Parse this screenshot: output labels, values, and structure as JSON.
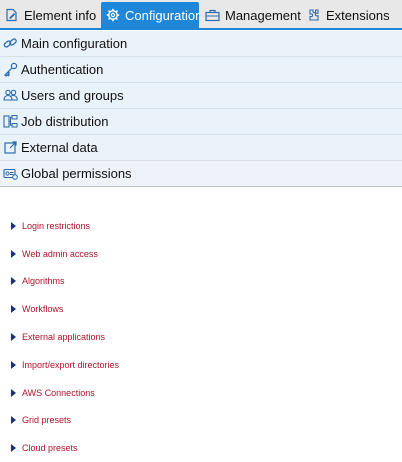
{
  "tabs": [
    {
      "label": "Element info",
      "icon": "edit-document-icon"
    },
    {
      "label": "Configuration",
      "icon": "gear-icon",
      "active": true
    },
    {
      "label": "Management",
      "icon": "toolbox-icon"
    },
    {
      "label": "Extensions",
      "icon": "puzzle-icon"
    }
  ],
  "sections": [
    {
      "label": "Main configuration",
      "icon": "link-chain-icon"
    },
    {
      "label": "Authentication",
      "icon": "key-icon"
    },
    {
      "label": "Users and groups",
      "icon": "users-icon"
    },
    {
      "label": "Job distribution",
      "icon": "network-distribution-icon"
    },
    {
      "label": "External data",
      "icon": "external-data-icon"
    },
    {
      "label": "Global permissions",
      "icon": "global-permissions-icon"
    }
  ],
  "permissions": [
    {
      "label": "Login restrictions"
    },
    {
      "label": "Web admin access"
    },
    {
      "label": "Algorithms"
    },
    {
      "label": "Workflows"
    },
    {
      "label": "External applications"
    },
    {
      "label": "Import/export directories"
    },
    {
      "label": "AWS Connections"
    },
    {
      "label": "Grid presets"
    },
    {
      "label": "Cloud presets"
    }
  ],
  "colors": {
    "accent": "#1f86d8",
    "link": "#b0122b",
    "triangle": "#1d2f78",
    "section_bg": "#eaf2f9"
  }
}
